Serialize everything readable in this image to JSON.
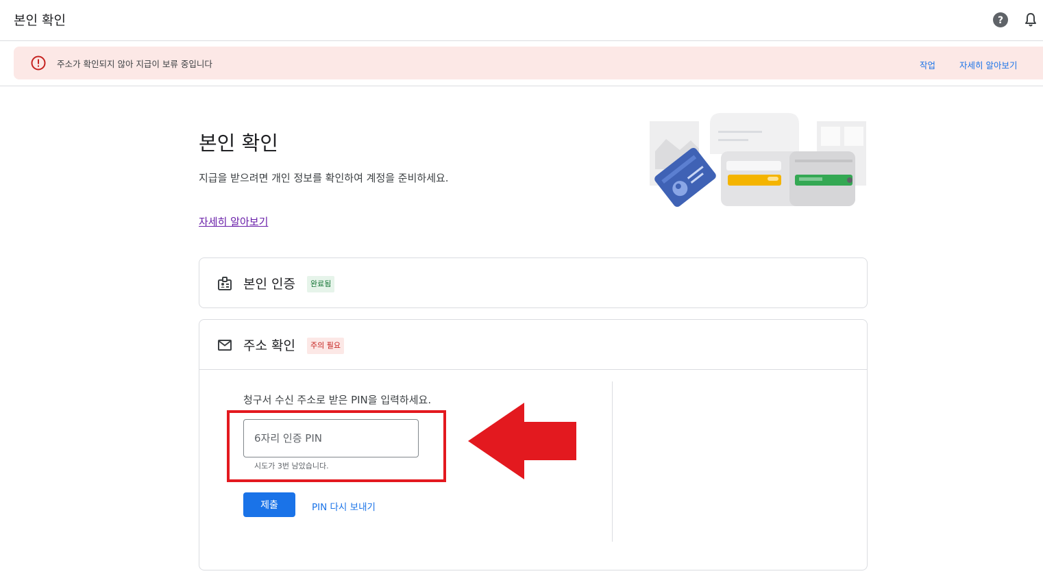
{
  "header": {
    "title": "본인 확인"
  },
  "banner": {
    "message": "주소가 확인되지 않아 지급이 보류 중입니다",
    "actions": [
      "작업",
      "자세히 알아보기"
    ]
  },
  "intro": {
    "title": "본인 확인",
    "description": "지급을 받으려면 개인 정보를 확인하여 계정을 준비하세요.",
    "learn_more": "자세히 알아보기"
  },
  "identity_card": {
    "title": "본인 인증",
    "status": "완료됨",
    "icon": "id-badge-icon"
  },
  "address_card": {
    "title": "주소 확인",
    "status": "주의 필요",
    "icon": "mail-icon",
    "prompt": "청구서 수신 주소로 받은 PIN을 입력하세요.",
    "pin_placeholder": "6자리 인증 PIN",
    "pin_value": "",
    "attempts_helper": "시도가 3번 남았습니다.",
    "submit_label": "제출",
    "resend_label": "PIN 다시 보내기"
  },
  "colors": {
    "accent": "#1a73e8",
    "error": "#c5221f",
    "success": "#137333",
    "annotation": "#e3191f"
  }
}
